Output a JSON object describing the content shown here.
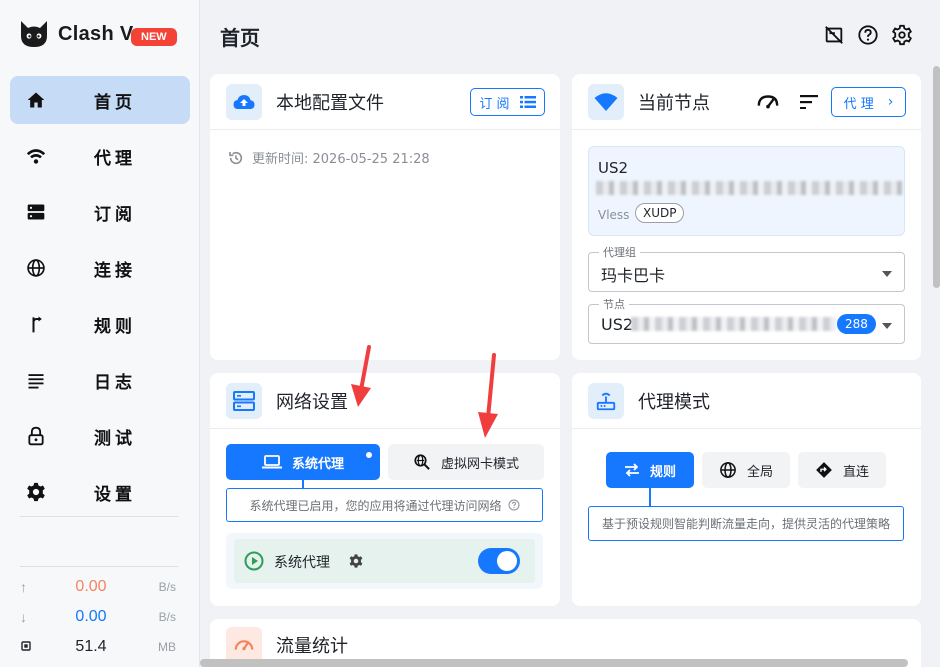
{
  "app": {
    "name": "Clash V",
    "badge": "NEW"
  },
  "sidebar": {
    "items": [
      {
        "label": "首页",
        "icon": "home-icon"
      },
      {
        "label": "代理",
        "icon": "wifi-icon"
      },
      {
        "label": "订阅",
        "icon": "storage-icon"
      },
      {
        "label": "连接",
        "icon": "globe-icon"
      },
      {
        "label": "规则",
        "icon": "fork-icon"
      },
      {
        "label": "日志",
        "icon": "list-icon"
      },
      {
        "label": "测试",
        "icon": "lock-icon"
      },
      {
        "label": "设置",
        "icon": "gear-icon"
      }
    ],
    "active_index": 0,
    "traffic": {
      "upload": {
        "value": "0.00",
        "unit": "B/s",
        "color": "#f4845f"
      },
      "download": {
        "value": "0.00",
        "unit": "B/s",
        "color": "#1677ff"
      },
      "memory": {
        "value": "51.4",
        "unit": "MB"
      }
    }
  },
  "header": {
    "title": "首页"
  },
  "profile_card": {
    "title": "本地配置文件",
    "subscribe_button": "订 阅",
    "update_time": "更新时间: 2026-05-25 21:28"
  },
  "node_card": {
    "title": "当前节点",
    "proxy_button": "代 理",
    "node_name": "US2",
    "node_type": "Vless",
    "node_tag": "XUDP",
    "group_label": "代理组",
    "group_value": "玛卡巴卡",
    "node_label": "节点",
    "node_value": "US2",
    "node_count": "288"
  },
  "network_card": {
    "title": "网络设置",
    "tab_system": "系统代理",
    "tab_tun": "虚拟网卡模式",
    "hint": "系统代理已启用，您的应用将通过代理访问网络",
    "row_label": "系统代理",
    "enabled": true
  },
  "mode_card": {
    "title": "代理模式",
    "mode_rule": "规则",
    "mode_global": "全局",
    "mode_direct": "直连",
    "hint": "基于预设规则智能判断流量走向，提供灵活的代理策略"
  },
  "traffic_card": {
    "title": "流量统计"
  },
  "colors": {
    "accent": "#1677ff",
    "active_bg": "#c6dcf6",
    "arrow": "#f03e3e",
    "toggle_row_bg": "#e5f2ee"
  }
}
